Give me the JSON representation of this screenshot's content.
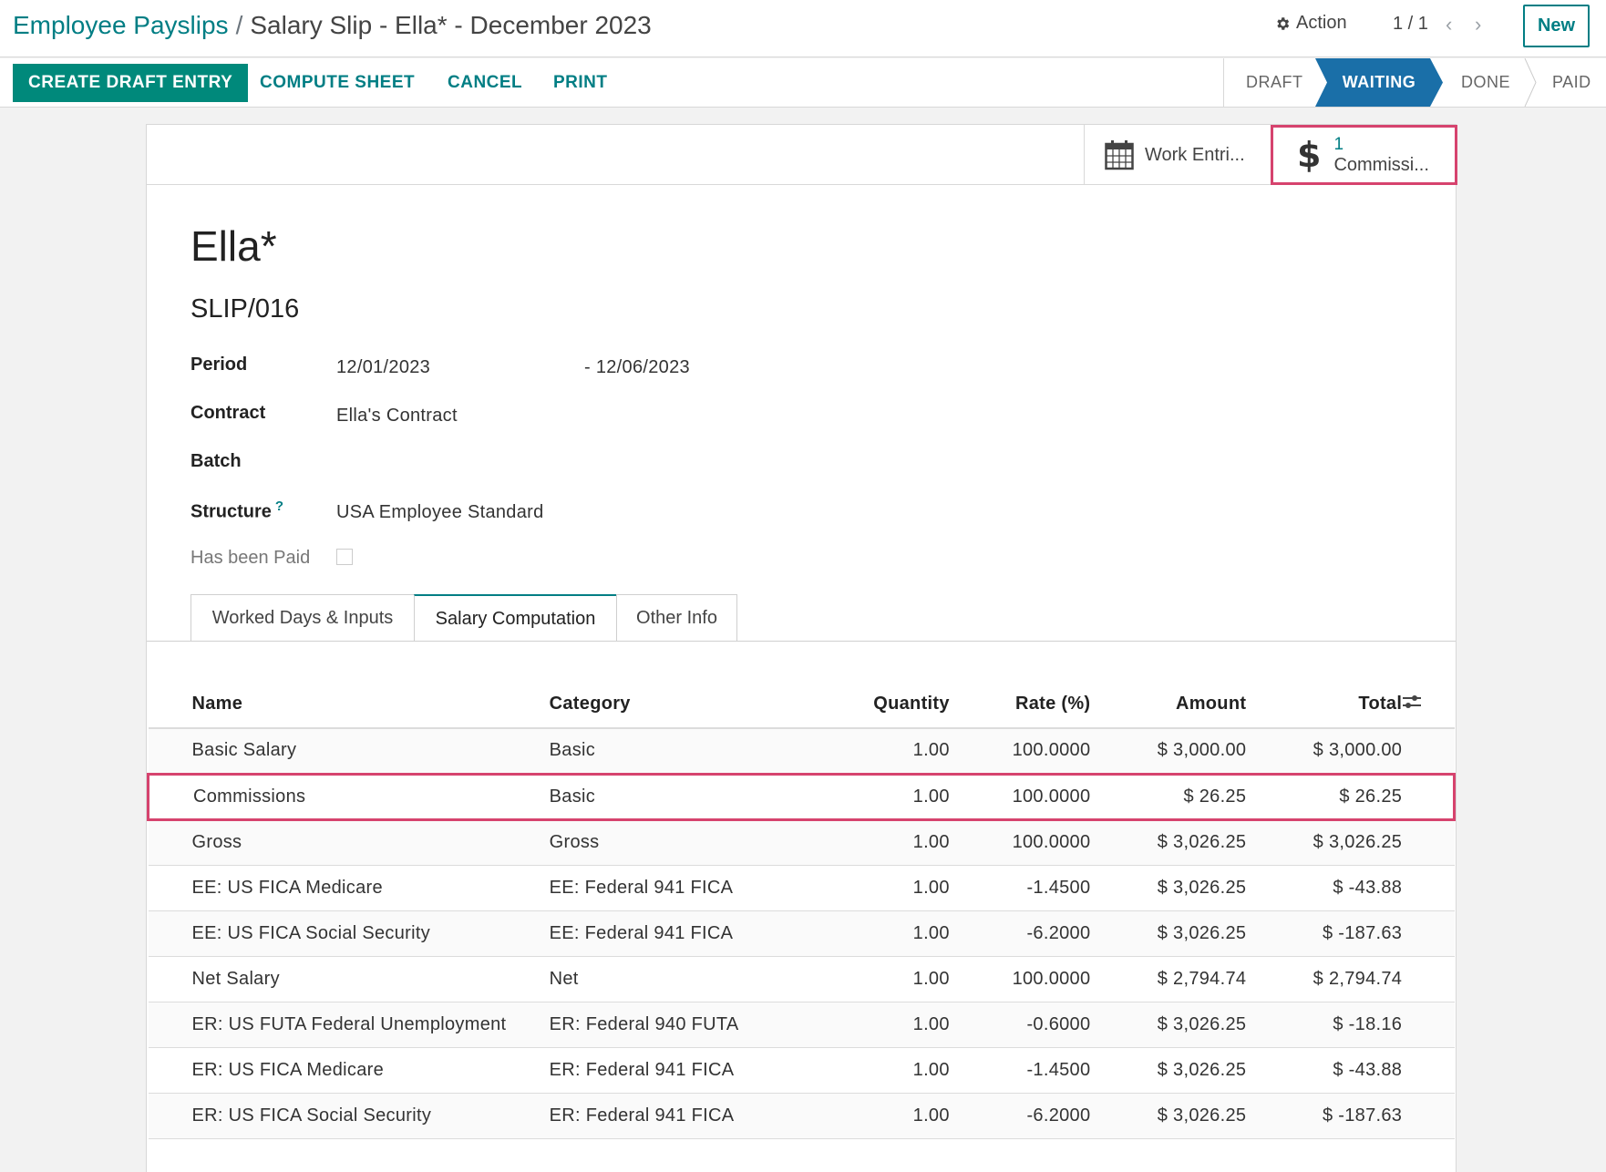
{
  "breadcrumb": {
    "parent": "Employee Payslips",
    "separator": "/",
    "current": "Salary Slip - Ella* - December 2023"
  },
  "header": {
    "action_label": "Action",
    "pager": "1 / 1",
    "new_label": "New",
    "icons": [
      "gear-icon",
      "chevron-left-icon",
      "chevron-right-icon"
    ]
  },
  "toolbar": {
    "create_draft_entry": "CREATE DRAFT ENTRY",
    "compute_sheet": "COMPUTE SHEET",
    "cancel": "CANCEL",
    "print": "PRINT"
  },
  "status": {
    "stages": [
      "DRAFT",
      "WAITING",
      "DONE",
      "PAID"
    ],
    "active": "WAITING"
  },
  "smart_buttons": {
    "work_entries": "Work Entri...",
    "commissions_count": "1",
    "commissions_label": "Commissi..."
  },
  "record": {
    "employee": "Ella*",
    "reference": "SLIP/016"
  },
  "fields": {
    "period_label": "Period",
    "period_start": "12/01/2023",
    "period_end": "- 12/06/2023",
    "contract_label": "Contract",
    "contract_value": "Ella's Contract",
    "batch_label": "Batch",
    "structure_label": "Structure",
    "structure_help": "?",
    "structure_value": "USA Employee Standard",
    "paid_label": "Has been Paid",
    "paid_value": false
  },
  "tabs": [
    "Worked Days & Inputs",
    "Salary Computation",
    "Other Info"
  ],
  "active_tab": "Salary Computation",
  "table": {
    "columns": [
      "Name",
      "Category",
      "Quantity",
      "Rate (%)",
      "Amount",
      "Total"
    ],
    "rows": [
      [
        "Basic Salary",
        "Basic",
        "1.00",
        "100.0000",
        "$ 3,000.00",
        "$ 3,000.00"
      ],
      [
        "Commissions",
        "Basic",
        "1.00",
        "100.0000",
        "$ 26.25",
        "$ 26.25"
      ],
      [
        "Gross",
        "Gross",
        "1.00",
        "100.0000",
        "$ 3,026.25",
        "$ 3,026.25"
      ],
      [
        "EE: US FICA Medicare",
        "EE: Federal 941 FICA",
        "1.00",
        "-1.4500",
        "$ 3,026.25",
        "$ -43.88"
      ],
      [
        "EE: US FICA Social Security",
        "EE: Federal 941 FICA",
        "1.00",
        "-6.2000",
        "$ 3,026.25",
        "$ -187.63"
      ],
      [
        "Net Salary",
        "Net",
        "1.00",
        "100.0000",
        "$ 2,794.74",
        "$ 2,794.74"
      ],
      [
        "ER: US FUTA Federal Unemployment",
        "ER: Federal 940 FUTA",
        "1.00",
        "-0.6000",
        "$ 3,026.25",
        "$ -18.16"
      ],
      [
        "ER: US FICA Medicare",
        "ER: Federal 941 FICA",
        "1.00",
        "-1.4500",
        "$ 3,026.25",
        "$ -43.88"
      ],
      [
        "ER: US FICA Social Security",
        "ER: Federal 941 FICA",
        "1.00",
        "-6.2000",
        "$ 3,026.25",
        "$ -187.63"
      ]
    ],
    "highlighted_row": 1
  },
  "colors": {
    "brand": "#017e84",
    "primary_button": "#00897b",
    "status_active": "#1a6fa8",
    "highlight_border": "#d6436e"
  }
}
